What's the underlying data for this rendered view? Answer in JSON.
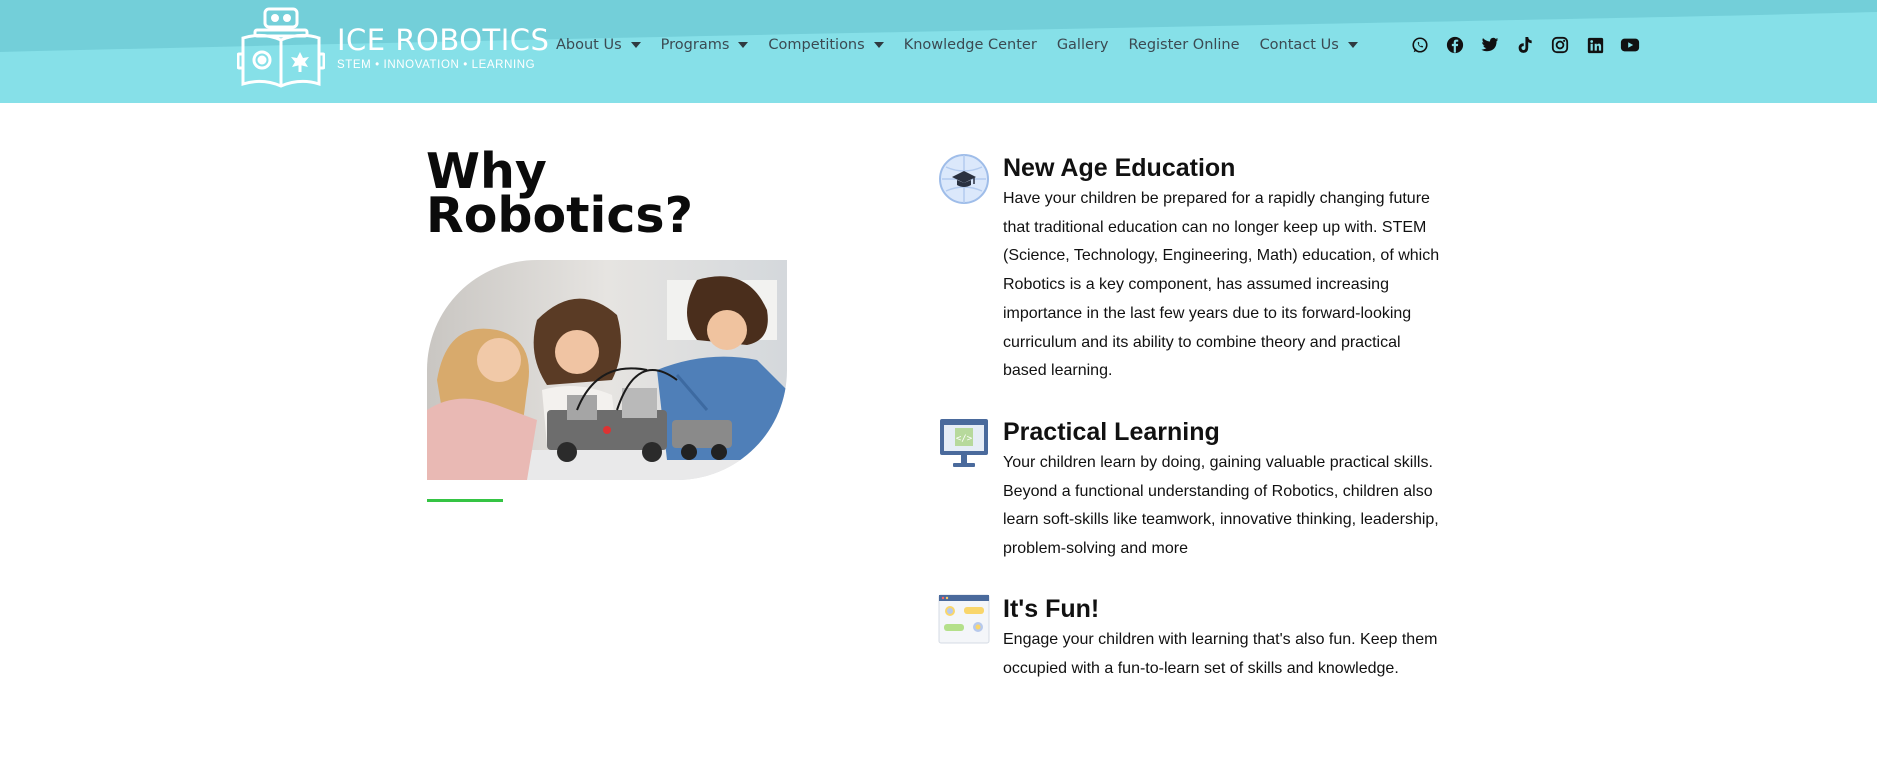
{
  "header": {
    "logo_title": "ICE ROBOTICS",
    "logo_tagline": "STEM • INNOVATION • LEARNING",
    "nav": [
      {
        "label": "About Us",
        "dropdown": true
      },
      {
        "label": "Programs",
        "dropdown": true
      },
      {
        "label": "Competitions",
        "dropdown": true
      },
      {
        "label": "Knowledge Center",
        "dropdown": false
      },
      {
        "label": "Gallery",
        "dropdown": false
      },
      {
        "label": "Register Online",
        "dropdown": false
      },
      {
        "label": "Contact Us",
        "dropdown": true
      }
    ],
    "social_icons": [
      "whatsapp-icon",
      "facebook-icon",
      "twitter-icon",
      "tiktok-icon",
      "instagram-icon",
      "linkedin-icon",
      "youtube-icon"
    ]
  },
  "why": {
    "title": "Why Robotics?"
  },
  "features": [
    {
      "icon": "graduation-globe-icon",
      "title": "New Age Education",
      "text": "Have your children be prepared for a rapidly changing future that traditional education can no longer keep up with. STEM (Science, Technology, Engineering, Math) education, of which Robotics is a key component, has assumed increasing importance in the last few years due to its forward-looking curriculum and its ability to combine theory and practical based learning."
    },
    {
      "icon": "code-monitor-icon",
      "title": "Practical Learning",
      "text": "Your children learn by doing, gaining valuable practical skills. Beyond a functional understanding of Robotics, children also learn soft-skills like teamwork, innovative thinking, leadership, problem-solving and more"
    },
    {
      "icon": "browser-window-icon",
      "title": "It's Fun!",
      "text": "Engage your children with learning that's also fun. Keep them occupied with a fun-to-learn set of skills and knowledge."
    }
  ],
  "colors": {
    "header_bg": "#86e0e8",
    "header_band": "#73cfd9",
    "accent_line": "#35c444",
    "nav_text": "#3b4a52"
  }
}
